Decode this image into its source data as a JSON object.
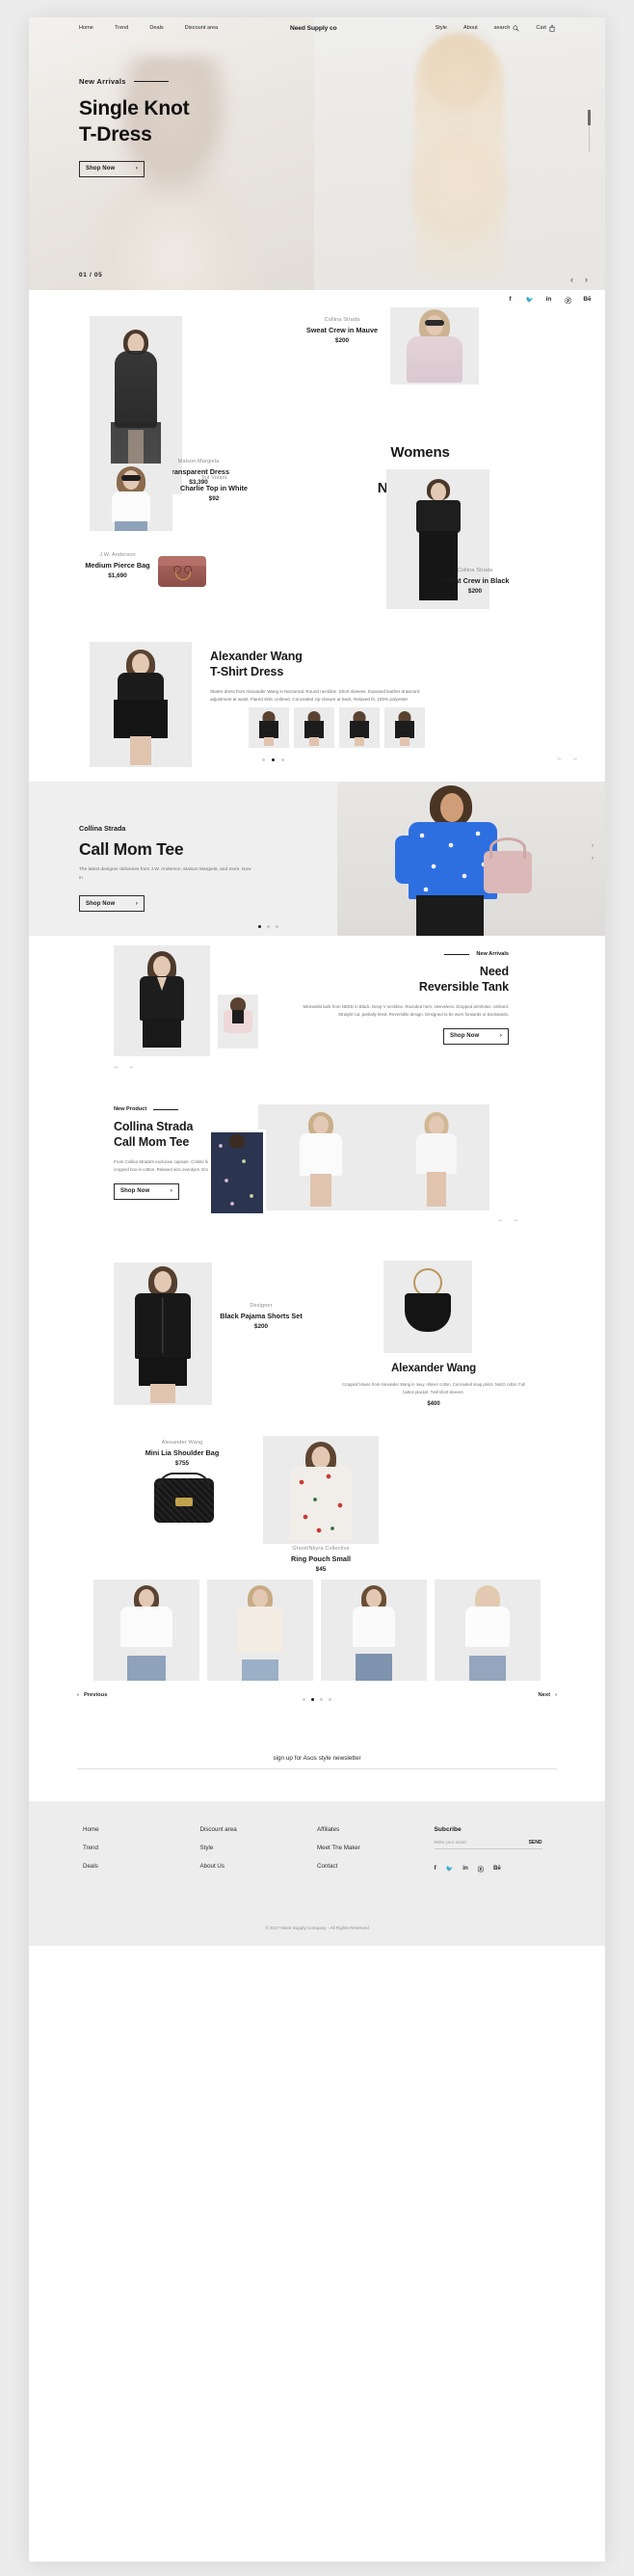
{
  "nav": {
    "left_items": [
      {
        "label": "Home"
      },
      {
        "label": "Trend"
      },
      {
        "label": "Deals"
      },
      {
        "label": "Discount area"
      }
    ],
    "logo": "Need Supply co",
    "right_items": [
      {
        "label": "Style"
      },
      {
        "label": "About"
      }
    ],
    "search_label": "search",
    "search_icon": "search-icon",
    "cart_label": "Cart",
    "cart_icon": "shopping-bag-icon"
  },
  "hero": {
    "eyebrow": "New Arrivals",
    "title_line1": "Single Knot",
    "title_line2": "T-Dress",
    "cta": "Shop Now",
    "cta_arrow": "›",
    "counter": "01 / 05",
    "prev": "‹",
    "next": "›"
  },
  "social": [
    {
      "name": "facebook-icon",
      "glyph": "f"
    },
    {
      "name": "twitter-icon",
      "glyph": "🐦"
    },
    {
      "name": "linkedin-icon",
      "glyph": "in"
    },
    {
      "name": "pinterest-icon",
      "glyph": "ⓟ"
    },
    {
      "name": "behance-icon",
      "glyph": "Bē"
    }
  ],
  "womens": {
    "heading": "Womens",
    "subheading": "New Arrivals",
    "products": {
      "transparent_dress": {
        "brand": "Maison Margiela",
        "name": "Transparent Dress",
        "price": "$3,390"
      },
      "sweat_mauve": {
        "brand": "Collina Strada",
        "name": "Sweat Crew in Mauve",
        "price": "$200"
      },
      "charlie_top": {
        "brand": "Toit Volant",
        "name": "Charlie Top in White",
        "price": "$92"
      },
      "sweat_black": {
        "brand": "Collina Strada",
        "name": "Sweat Crew in Black",
        "price": "$200"
      },
      "pierce_bag": {
        "brand": "J.W. Anderson",
        "name": "Medium Pierce Bag",
        "price": "$1,690"
      }
    }
  },
  "alexander_wang": {
    "title_line1": "Alexander Wang",
    "title_line2": "T-Shirt Dress",
    "description": "Skater dress from Alexander Wang in Nocturnal. Round neckline. Short sleeves. Exposed leather drawcord adjustment at waist. Flared skirt. Unlined. Concealed zip closure at back. Relaxed fit. 100% polyester.",
    "prev": "←",
    "next": "→"
  },
  "call_mom_banner": {
    "brand": "Collina Strada",
    "title": "Call Mom Tee",
    "description": "The latest designer deliveries from J.W. Anderson, Maison Margiela, and more. Now in",
    "cta": "Shop Now",
    "cta_arrow": "›",
    "side_prev": "‹",
    "side_next": "›"
  },
  "reversible_tank": {
    "eyebrow": "New Arrivals",
    "title_line1": "Need",
    "title_line2": "Reversible Tank",
    "description": "Minimalist tank from NEED in Black. Deep V neckline. Rounded hem, sleeveless. Dropped armholes. Unlined. Straight cut, partially lined. Reversible design. Designed to be worn forwards or backwards.",
    "cta": "Shop Now",
    "cta_arrow": "›",
    "prev": "←",
    "next": "→"
  },
  "collina_strada": {
    "eyebrow": "New Product",
    "title_line1": "Collina Strada",
    "title_line2": "Call Mom Tee",
    "description": "From Collina Strada's exclusive capsule. Crinkle finish cotton. Ribbed crewneck collarless, a cropped box-in cotton. Relaxed size overdyes. Embroidered.",
    "cta": "Shop Now",
    "cta_arrow": "›",
    "prev": "←",
    "next": "→"
  },
  "pyjama": {
    "brand": "Designer",
    "name": "Black Pajama Shorts Set",
    "price": "$200",
    "feature_title": "Alexander Wang",
    "feature_description": "Cropped blouse from Alexander Wang in navy. Allover cotton. Concealed snap prints. Notch collar. Full button placket. Twill short sleeves.",
    "feature_price": "$400"
  },
  "mini_lia": {
    "brand": "Alexander Wang",
    "name": "Mini Lia Shoulder Bag",
    "price": "$755",
    "brand2": "Ghost/Nkyra Collective",
    "name2": "Ring Pouch Small",
    "price2": "$45"
  },
  "bottom_carousel": {
    "prev": "Previous",
    "prev_arrow": "‹",
    "next": "Next",
    "next_arrow": "›"
  },
  "newsletter": {
    "text": "sign up for Asos style newsletter"
  },
  "footer": {
    "col1": [
      {
        "label": "Home"
      },
      {
        "label": "Trend"
      },
      {
        "label": "Deals"
      }
    ],
    "col2": [
      {
        "label": "Discount area"
      },
      {
        "label": "Style"
      },
      {
        "label": "About Us"
      }
    ],
    "col3": [
      {
        "label": "Affiliates"
      },
      {
        "label": "Meet The Maker"
      },
      {
        "label": "Contact"
      }
    ],
    "subscribe_title": "Subcribe",
    "subscribe_placeholder": "Write your email",
    "send_label": "SEND",
    "social": [
      {
        "name": "facebook-icon",
        "glyph": "f"
      },
      {
        "name": "twitter-icon",
        "glyph": "🐦"
      },
      {
        "name": "linkedin-icon",
        "glyph": "in"
      },
      {
        "name": "pinterest-icon",
        "glyph": "ⓟ"
      },
      {
        "name": "behance-icon",
        "glyph": "Bē"
      }
    ],
    "copyright": "© 2017 Need Supply Company - All Rights Reserved"
  },
  "colors": {
    "page_bg": "#ececec",
    "card_bg": "#ffffff",
    "placeholder": "#ebebeb",
    "banner_bg": "#efefef",
    "footer_bg": "#ededed",
    "text": "#1a1a1a",
    "muted": "#8e8e8e"
  }
}
